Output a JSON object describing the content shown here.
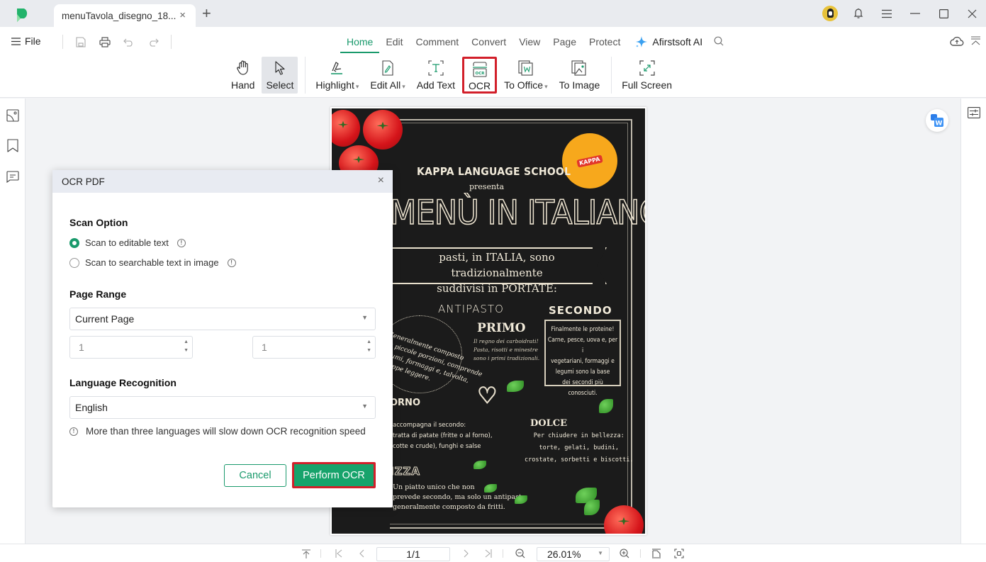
{
  "titlebar": {
    "tab_title": "menuTavola_disegno_18...",
    "tab_close": "×",
    "new_tab": "+"
  },
  "toolbar": {
    "file_label": "File",
    "menu_tabs": [
      "Home",
      "Edit",
      "Comment",
      "Convert",
      "View",
      "Page",
      "Protect"
    ],
    "active_tab": "Home",
    "ai_label": "Afirstsoft AI",
    "ribbon": {
      "hand": "Hand",
      "select": "Select",
      "highlight": "Highlight",
      "edit_all": "Edit All",
      "add_text": "Add Text",
      "ocr": "OCR",
      "to_office": "To Office",
      "to_image": "To Image",
      "full_screen": "Full Screen"
    },
    "caret": "▾"
  },
  "colors": {
    "accent": "#1a9a6c",
    "highlight_red": "#d21f2a",
    "primary_button": "#17a36b"
  },
  "dialog": {
    "title": "OCR PDF",
    "close": "×",
    "scan_option_title": "Scan Option",
    "scan_options": [
      {
        "label": "Scan to editable text",
        "checked": true
      },
      {
        "label": "Scan to searchable text in image",
        "checked": false
      }
    ],
    "page_range_title": "Page Range",
    "page_range_value": "Current Page",
    "page_from": "1",
    "page_to": "1",
    "language_title": "Language Recognition",
    "language_value": "English",
    "warning": "More than three languages will slow down OCR recognition speed",
    "cancel_label": "Cancel",
    "perform_label": "Perform OCR",
    "info_glyph": "!"
  },
  "document": {
    "school": "KAPPA LANGUAGE SCHOOL",
    "presenta": "presenta",
    "title": "MENÙ IN ITALIANO",
    "banner_line1": "pasti, in ITALIA, sono tradizionalmente",
    "banner_line2": "suddivisi in PORTATE:",
    "badge": "KAPPA",
    "antipasto": "ANTIPASTO",
    "antipasto_text": "Generalmente composto\nda piccole porzioni, comprende\nsalumi, formaggi e, talvolta,\ne zuppe leggere.",
    "primo": "PRIMO",
    "primo_text": "Il regno dei carboidrati!\nPasta, risotti e minestre\nsono i primi tradizionali.",
    "secondo": "SECONDO",
    "secondo_text": "Finalmente le proteine!\nCarne, pesce, uova e, per i\nvegetariani, formaggi e\nlegumi sono la base\ndei secondi più conosciuti.",
    "contorno": "ORNO",
    "contorno_text": "accompagna il secondo:\ntratta di patate (fritte o al forno),\ncotte e crude), funghi e salse",
    "dolce": "DOLCE",
    "dolce_text": "Per chiudere in bellezza:\ntorte, gelati, budini,\ncrostate, sorbetti e biscotti.",
    "pizza": "IZZA",
    "pizza_text": "Un piatto unico che non\nprevede secondo, ma solo un antipasto,\ngeneralmente composto da fritti."
  },
  "bottombar": {
    "page_indicator": "1/1",
    "zoom_level": "26.01%"
  }
}
